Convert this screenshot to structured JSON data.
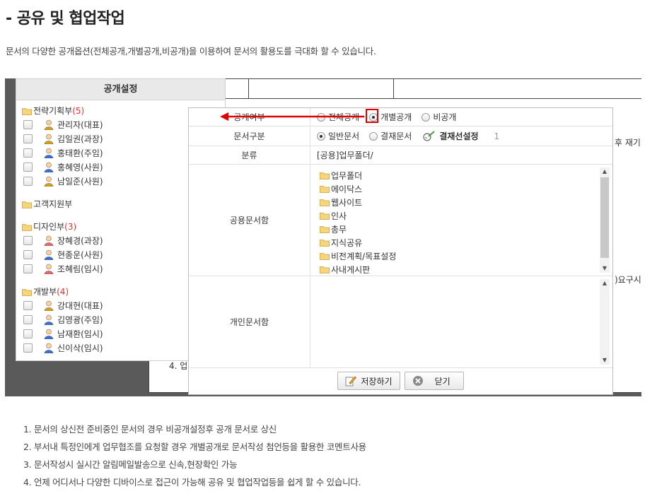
{
  "page": {
    "title": "- 공유 및 협업작업",
    "description": "문서의 다양한 공개옵션(전체공개,개별공개,비공개)을 이용하여 문서의 활용도를 극대화 할 수 있습니다."
  },
  "background": {
    "frag_right1": "후 재기",
    "frag_right2": ")요구시",
    "frag_left": "4. 업"
  },
  "share_panel": {
    "title": "공개설정",
    "departments": [
      {
        "name": "전략기획부",
        "count": "(5)",
        "members": [
          {
            "name": "관리자(대표)",
            "color": "#d4a017"
          },
          {
            "name": "김일권(과장)",
            "color": "#d4a017"
          },
          {
            "name": "홍태환(주임)",
            "color": "#3a6fd8"
          },
          {
            "name": "홍혜영(사원)",
            "color": "#3a6fd8"
          },
          {
            "name": "남일준(사원)",
            "color": "#d4a017"
          }
        ]
      },
      {
        "name": "고객지원부",
        "count": "",
        "members": []
      },
      {
        "name": "디자인부",
        "count": "(3)",
        "members": [
          {
            "name": "장혜경(과장)",
            "color": "#e06a6a"
          },
          {
            "name": "현종운(사원)",
            "color": "#3a6fd8"
          },
          {
            "name": "조혜림(임시)",
            "color": "#e06a6a"
          }
        ]
      },
      {
        "name": "개발부",
        "count": "(4)",
        "members": [
          {
            "name": "강대현(대표)",
            "color": "#d4a017"
          },
          {
            "name": "김영광(주임)",
            "color": "#3a6fd8"
          },
          {
            "name": "남재환(임시)",
            "color": "#3a6fd8"
          },
          {
            "name": "신이삭(임시)",
            "color": "#3a6fd8"
          }
        ]
      }
    ]
  },
  "dialog": {
    "public_label": "공개여부",
    "public_options": [
      {
        "label": "전체공개",
        "selected": false
      },
      {
        "label": "개별공개",
        "selected": true
      },
      {
        "label": "비공개",
        "selected": false
      }
    ],
    "doctype_label": "문서구분",
    "doctype_options": [
      {
        "label": "일반문서",
        "selected": true
      },
      {
        "label": "결재문서",
        "selected": false
      }
    ],
    "approval_setting": "결재선설정",
    "approval_count": "1",
    "category_label": "분류",
    "category_value": "[공용]업무폴더/",
    "shared_box_label": "공용문서함",
    "shared_folders": [
      "업무폴더",
      "에이닥스",
      "웹사이트",
      "인사",
      "총무",
      "지식공유",
      "비전계획/목표설정",
      "사내게시판"
    ],
    "personal_box_label": "개인문서함",
    "save_label": "저장하기",
    "close_label": "닫기"
  },
  "notes": [
    "1. 문서의 상신전 준비중인 문서의 경우 비공개설정후 공개 문서로 상신",
    "2. 부서내 특정인에게 업무협조를 요청할 경우 개별공개로 문서작성 첨언등을 활용한 코멘트사용",
    "3. 문서작성시 실시간 알림메일발송으로 신속,현장확인 가능",
    "4. 언제 어디서나 다양한 디바이스로 접근이 가능해 공유 및 협업작업등을 쉽게 할 수 있습니다."
  ]
}
